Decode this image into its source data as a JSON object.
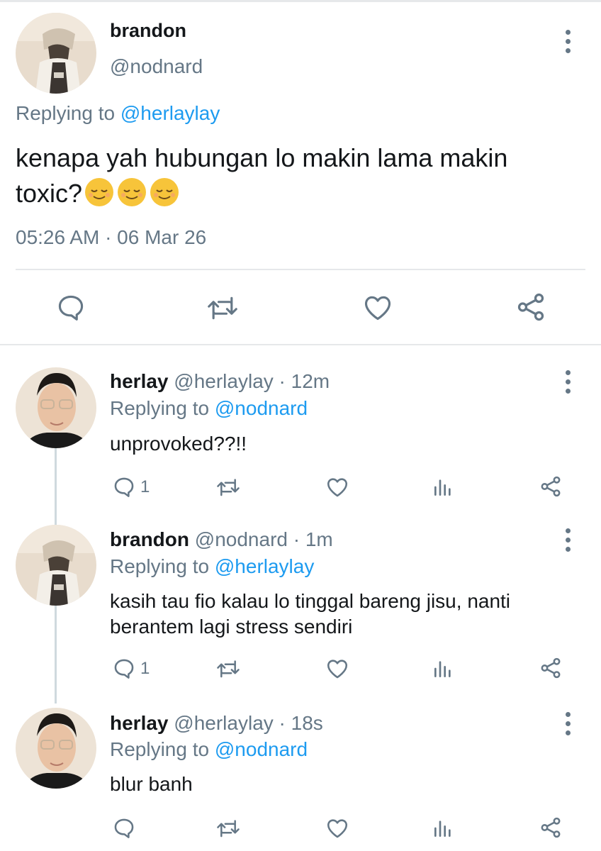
{
  "main_tweet": {
    "author_name": "brandon",
    "author_handle": "@nodnard",
    "replying_prefix": "Replying to ",
    "replying_to": "@herlaylay",
    "text_line1": "kenapa yah hubungan lo makin lama makin",
    "text_line2": "toxic?",
    "emoji": "relieved-face",
    "emoji_count": 3,
    "timestamp": "05:26 AM · 06 Mar 26"
  },
  "replies": [
    {
      "author_name": "herlay",
      "author_handle": "@herlaylay",
      "time": "· 12m",
      "replying_prefix": "Replying to ",
      "replying_to": "@nodnard",
      "text": "unprovoked??!!",
      "reply_count": "1"
    },
    {
      "author_name": "brandon",
      "author_handle": "@nodnard",
      "time": "· 1m",
      "replying_prefix": "Replying to ",
      "replying_to": "@herlaylay",
      "text": "kasih tau fio kalau lo tinggal bareng jisu, nanti berantem lagi stress sendiri",
      "reply_count": "1"
    },
    {
      "author_name": "herlay",
      "author_handle": "@herlaylay",
      "time": "· 18s",
      "replying_prefix": "Replying to ",
      "replying_to": "@nodnard",
      "text": "blur banh",
      "reply_count": ""
    }
  ],
  "colors": {
    "link": "#1d9bf0",
    "muted": "#657786",
    "text": "#14171a",
    "thread": "#cfd9de"
  },
  "icons": [
    "reply-icon",
    "retweet-icon",
    "like-icon",
    "analytics-icon",
    "share-icon",
    "more-icon"
  ]
}
